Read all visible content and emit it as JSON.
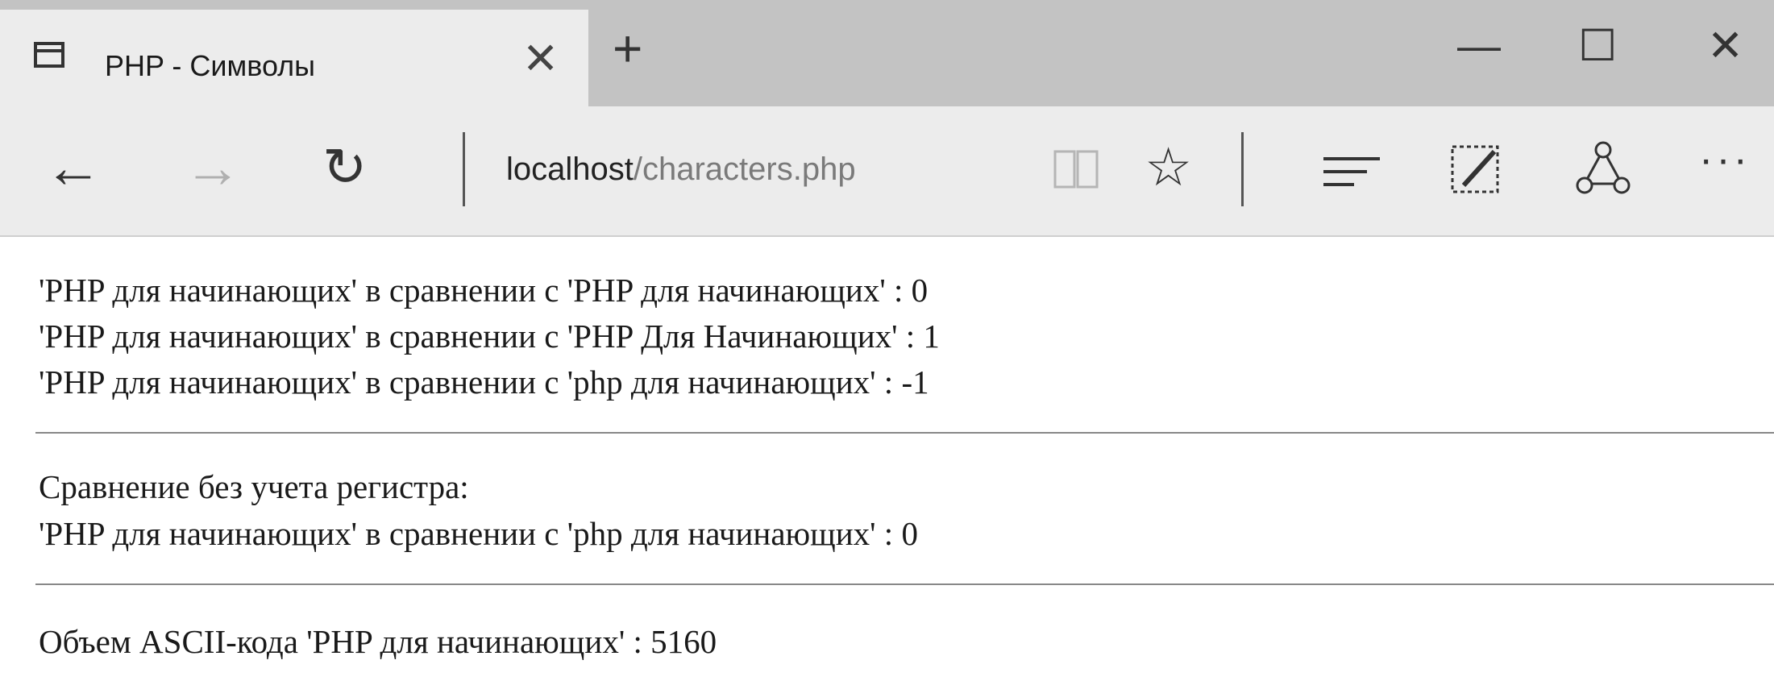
{
  "tab": {
    "title": "PHP - Символы",
    "close_glyph": "✕",
    "new_tab_glyph": "+"
  },
  "window_controls": {
    "minimize": "—",
    "maximize": "☐",
    "close": "✕"
  },
  "toolbar": {
    "back_glyph": "←",
    "forward_glyph": "→",
    "refresh_glyph": "↻",
    "favorite_glyph": "☆",
    "more_glyph": "···",
    "icons": [
      "back-icon",
      "forward-icon",
      "refresh-icon",
      "reading-view-icon",
      "favorite-star-icon",
      "hub-icon",
      "web-note-icon",
      "share-icon",
      "more-icon"
    ]
  },
  "address": {
    "host": "localhost",
    "path": "/characters.php"
  },
  "content": {
    "compare_lines": [
      "'PHP для начинающих' в сравнении с 'PHP для начинающих' : 0",
      "'PHP для начинающих' в сравнении с 'PHP Для Начинающих' : 1",
      "'PHP для начинающих' в сравнении с 'php для начинающих' : -1"
    ],
    "case_insensitive_heading": "Сравнение без учета регистра:",
    "case_insensitive_line": "'PHP для начинающих' в сравнении с 'php для начинающих' : 0",
    "ascii_line": "Объем ASCII-кода 'PHP для начинающих' : 5160"
  }
}
